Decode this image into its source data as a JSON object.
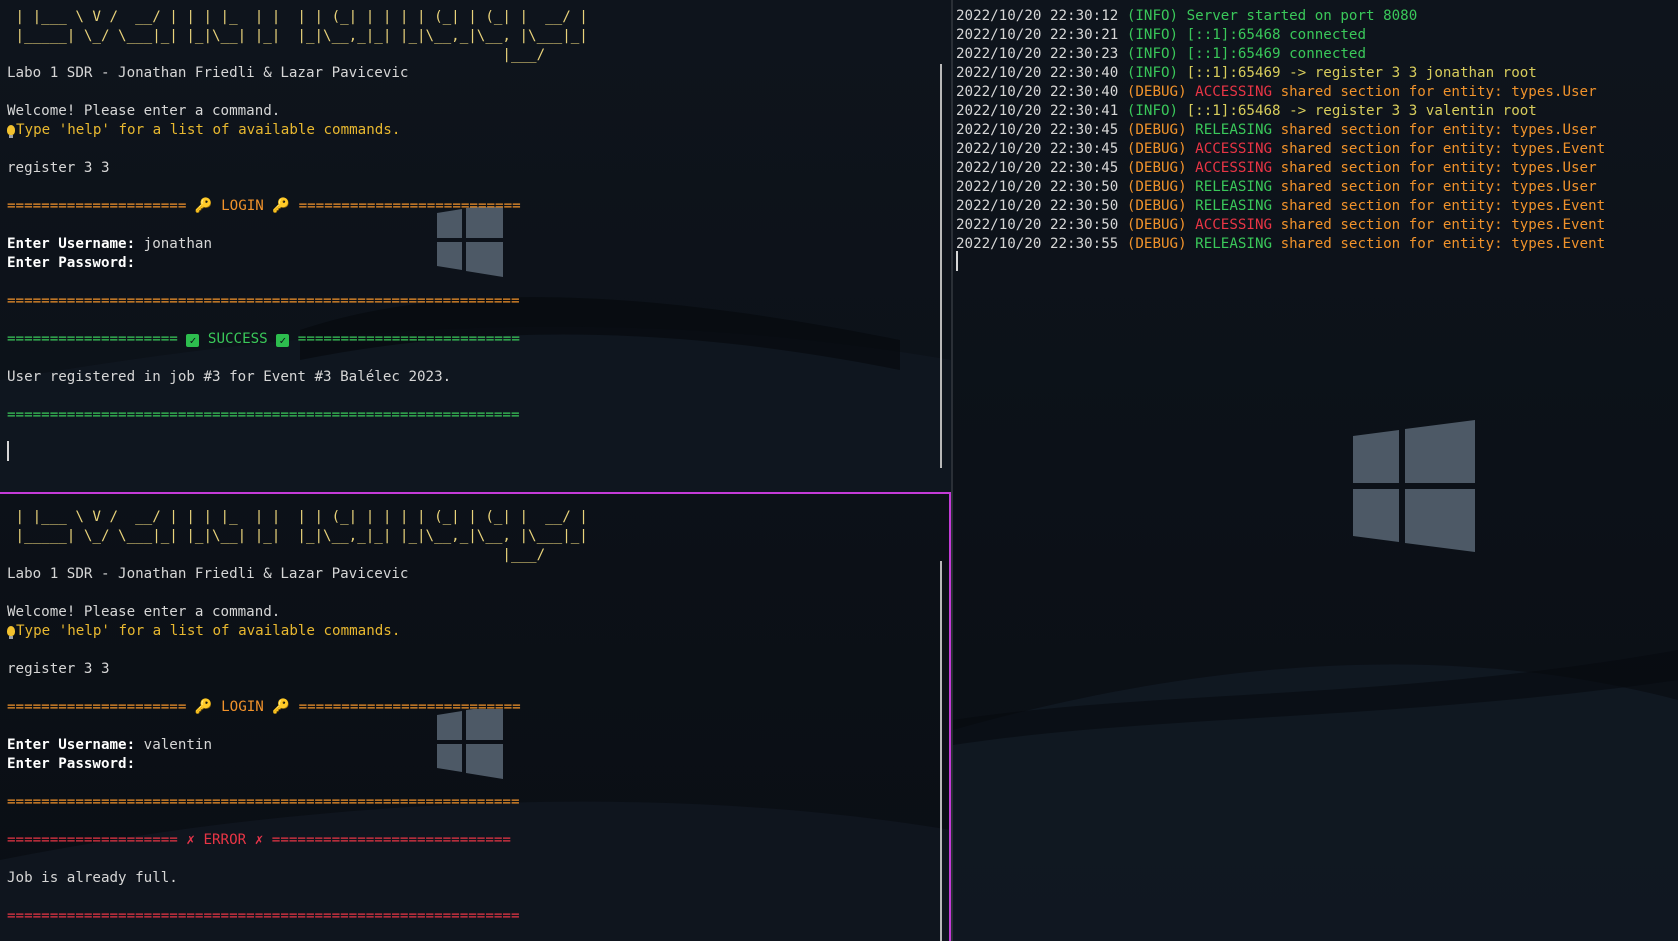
{
  "colors": {
    "divider_active": "#c43bd8",
    "ascii": "#e8d27a",
    "hint": "#e8b830",
    "login_banner": "#f0922b",
    "success": "#3ac85a",
    "error": "#e83545"
  },
  "top_left": {
    "ascii_line_1": " | |___ \\ V /  __/ | | | |_  | |  | | (_| | | | | (_| | (_| |  __/ |",
    "ascii_line_2": " |_____| \\_/ \\___|_| |_|\\__| |_|  |_|\\__,_|_| |_|\\__,_|\\__, |\\___|_|",
    "ascii_line_3": "                                                          |___/",
    "title": "Labo 1 SDR - Jonathan Friedli & Lazar Pavicevic",
    "welcome": "Welcome! Please enter a command.",
    "hint": "Type 'help' for a list of available commands.",
    "command": "register 3 3",
    "login_left": "===================== ",
    "login_label": " LOGIN ",
    "login_right": " ==========================",
    "username_label": "Enter Username:",
    "username_value": " jonathan",
    "password_label": "Enter Password:",
    "rule_orange": "============================================================",
    "success_left": "==================== ",
    "success_label": " SUCCESS ",
    "success_right": " ==========================",
    "result": "User registered in job #3 for Event #3 Balélec 2023.",
    "rule_green": "============================================================"
  },
  "bottom_left": {
    "ascii_line_1": " | |___ \\ V /  __/ | | | |_  | |  | | (_| | | | | (_| | (_| |  __/ |",
    "ascii_line_2": " |_____| \\_/ \\___|_| |_|\\__| |_|  |_|\\__,_|_| |_|\\__,_|\\__, |\\___|_|",
    "ascii_line_3": "                                                          |___/",
    "title": "Labo 1 SDR - Jonathan Friedli & Lazar Pavicevic",
    "welcome": "Welcome! Please enter a command.",
    "hint": "Type 'help' for a list of available commands.",
    "command": "register 3 3",
    "login_left": "===================== ",
    "login_label": " LOGIN ",
    "login_right": " ==========================",
    "username_label": "Enter Username:",
    "username_value": " valentin",
    "password_label": "Enter Password:",
    "rule_orange": "============================================================",
    "error_left": "==================== ",
    "error_label": " ERROR ",
    "error_right": " ============================",
    "result": "Job is already full.",
    "rule_red": "============================================================"
  },
  "server_log": [
    {
      "ts": "2022/10/20 22:30:12",
      "level": "(INFO)",
      "kind": "info",
      "pre": "",
      "msg": " Server started on port 8080",
      "msgclass": "msg-g"
    },
    {
      "ts": "2022/10/20 22:30:21",
      "level": "(INFO)",
      "kind": "info",
      "pre": "",
      "msg": " [::1]:65468 connected",
      "msgclass": "msg-g"
    },
    {
      "ts": "2022/10/20 22:30:23",
      "level": "(INFO)",
      "kind": "info",
      "pre": "",
      "msg": " [::1]:65469 connected",
      "msgclass": "msg-g"
    },
    {
      "ts": "2022/10/20 22:30:40",
      "level": "(INFO)",
      "kind": "info",
      "pre": "",
      "msg": " [::1]:65469 -> register 3 3 jonathan root",
      "msgclass": "msg-y"
    },
    {
      "ts": "2022/10/20 22:30:40",
      "level": "(DEBUG)",
      "kind": "debug",
      "pre": " ACCESSING",
      "prec": "acc",
      "msg": " shared section for entity: types.User",
      "msgclass": "msg-o"
    },
    {
      "ts": "2022/10/20 22:30:41",
      "level": "(INFO)",
      "kind": "info",
      "pre": "",
      "msg": " [::1]:65468 -> register 3 3 valentin root",
      "msgclass": "msg-y"
    },
    {
      "ts": "2022/10/20 22:30:45",
      "level": "(DEBUG)",
      "kind": "debug",
      "pre": " RELEASING",
      "prec": "rel",
      "msg": " shared section for entity: types.User",
      "msgclass": "msg-o"
    },
    {
      "ts": "2022/10/20 22:30:45",
      "level": "(DEBUG)",
      "kind": "debug",
      "pre": " ACCESSING",
      "prec": "acc",
      "msg": " shared section for entity: types.Event",
      "msgclass": "msg-o"
    },
    {
      "ts": "2022/10/20 22:30:45",
      "level": "(DEBUG)",
      "kind": "debug",
      "pre": " ACCESSING",
      "prec": "acc",
      "msg": " shared section for entity: types.User",
      "msgclass": "msg-o"
    },
    {
      "ts": "2022/10/20 22:30:50",
      "level": "(DEBUG)",
      "kind": "debug",
      "pre": " RELEASING",
      "prec": "rel",
      "msg": " shared section for entity: types.User",
      "msgclass": "msg-o"
    },
    {
      "ts": "2022/10/20 22:30:50",
      "level": "(DEBUG)",
      "kind": "debug",
      "pre": " RELEASING",
      "prec": "rel",
      "msg": " shared section for entity: types.Event",
      "msgclass": "msg-o"
    },
    {
      "ts": "2022/10/20 22:30:50",
      "level": "(DEBUG)",
      "kind": "debug",
      "pre": " ACCESSING",
      "prec": "acc",
      "msg": " shared section for entity: types.Event",
      "msgclass": "msg-o"
    },
    {
      "ts": "2022/10/20 22:30:55",
      "level": "(DEBUG)",
      "kind": "debug",
      "pre": " RELEASING",
      "prec": "rel",
      "msg": " shared section for entity: types.Event",
      "msgclass": "msg-o"
    }
  ]
}
